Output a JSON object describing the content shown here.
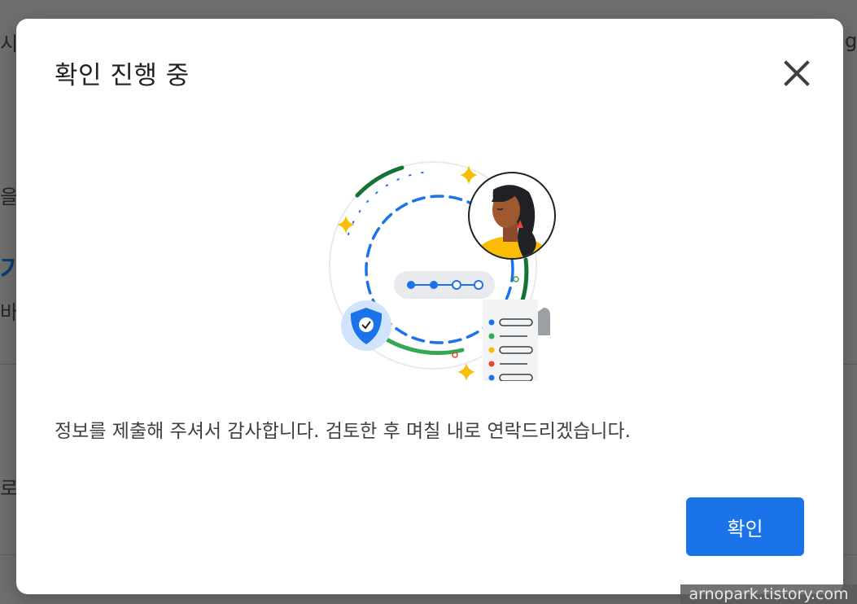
{
  "background": {
    "fragments": [
      "시",
      "g",
      "을",
      "기",
      "바",
      "로거"
    ]
  },
  "dialog": {
    "title": "확인 진행 중",
    "message": "정보를 제출해 주셔서 감사합니다. 검토한 후 며칠 내로 연락드리겠습니다.",
    "ok_label": "확인",
    "close_icon": "close-icon"
  },
  "illustration": {
    "icons": [
      "sparkle-icon",
      "avatar",
      "shield-check-icon",
      "document-list-icon",
      "progress-steps"
    ],
    "colors": {
      "blue": "#1a73e8",
      "green": "#34a853",
      "dark_green": "#137333",
      "yellow": "#fbbc04",
      "red": "#ea4335",
      "shield_bg": "#d2e3fc"
    }
  },
  "watermark": "arnopark.tistory.com",
  "colors": {
    "scrim": "#6f6f6f",
    "primary": "#1a73e8",
    "title_text": "#202124",
    "body_text": "#3c4043"
  }
}
